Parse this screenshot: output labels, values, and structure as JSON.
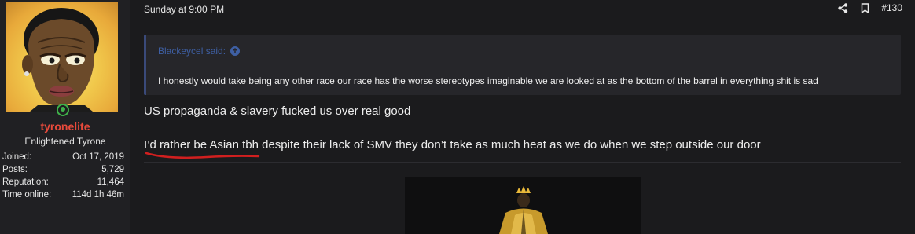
{
  "user": {
    "username": "tyronelite",
    "title": "Enlightened Tyrone",
    "stats": [
      {
        "label": "Joined:",
        "value": "Oct 17, 2019"
      },
      {
        "label": "Posts:",
        "value": "5,729"
      },
      {
        "label": "Reputation:",
        "value": "11,464"
      },
      {
        "label": "Time online:",
        "value": "114d 1h 46m"
      }
    ],
    "avatar_icon": "cartoon-avatar",
    "online_icon": "online-status-icon"
  },
  "post": {
    "date": "Sunday at 9:00 PM",
    "number": "#130",
    "quote": {
      "author": "Blackeycel said:",
      "text": "I honestly would take being any other race our race has the worse stereotypes imaginable we are looked at as the bottom of the barrel in everything shit is sad"
    },
    "lines": [
      "US propaganda & slavery fucked us over real good",
      "I’d rather be Asian tbh despite their lack of SMV they don’t take as much heat as we do when we step outside our door"
    ]
  },
  "colors": {
    "background": "#1b1b1d",
    "username": "#e84a3b",
    "quote_author": "#3e5fa3",
    "online": "#3fb24a",
    "annotation": "#d11f1f"
  }
}
